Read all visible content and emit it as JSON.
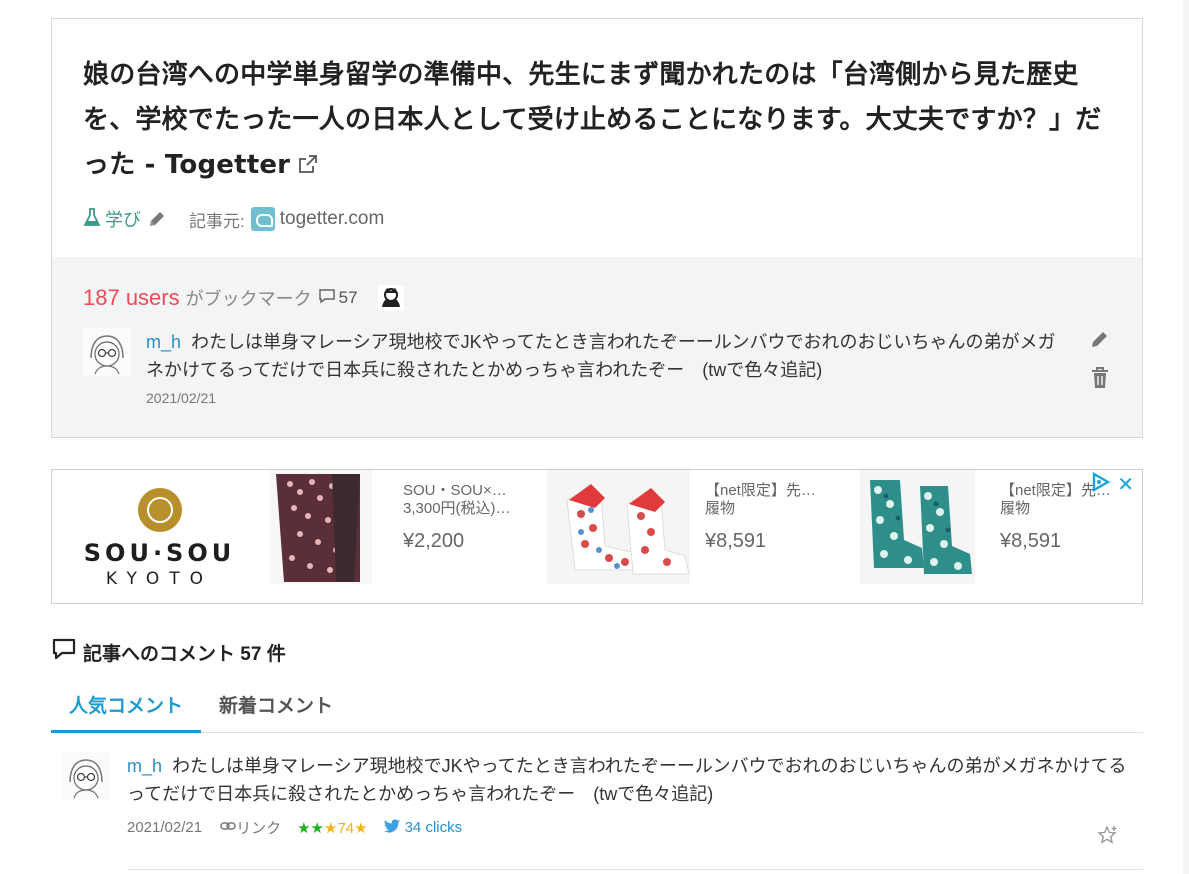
{
  "entry": {
    "title": "娘の台湾への中学単身留学の準備中、先生にまず聞かれたのは「台湾側から見た歴史を、学校でたった一人の日本人として受け止めることになります。大丈夫ですか？」だった - Togetter",
    "category": "学び",
    "source_label": "記事元:",
    "source_domain": "togetter.com"
  },
  "bookmarks": {
    "count": "187 users",
    "suffix": "がブックマーク",
    "comment_count": "57"
  },
  "my_comment": {
    "user": "m_h",
    "text": "わたしは単身マレーシア現地校でJKやってたとき言われたぞーールンバウでおれのおじいちゃんの弟がメガネかけてるってだけで日本兵に殺されたとかめっちゃ言われたぞー　(twで色々追記)",
    "date": "2021/02/21"
  },
  "ad": {
    "brand": "SOU·SOU",
    "brand_sub": "KYOTO",
    "items": [
      {
        "text": "SOU・SOU×…\n3,300円(税込)…",
        "price": "¥2,200"
      },
      {
        "text": "【net限定】先…\n履物",
        "price": "¥8,591"
      },
      {
        "text": "【net限定】先…\n履物",
        "price": "¥8,591"
      }
    ],
    "close": "✕"
  },
  "comments_section": {
    "heading": "記事へのコメント 57 件",
    "tabs": [
      "人気コメント",
      "新着コメント"
    ]
  },
  "top_comment": {
    "user": "m_h",
    "text": "わたしは単身マレーシア現地校でJKやってたとき言われたぞーールンバウでおれのおじいちゃんの弟がメガネかけてるってだけで日本兵に殺されたとかめっちゃ言われたぞー　(twで色々追記)",
    "date": "2021/02/21",
    "link_label": "リンク",
    "stars_green": "★★",
    "stars_yellow_a": "★",
    "star_count": "74",
    "stars_yellow_b": "★",
    "clicks": "34 clicks"
  },
  "colors": {
    "users_red": "#f04a55",
    "link_blue": "#2a8fc5",
    "tab_active": "#1d9bd1",
    "category_green": "#3c9a8a",
    "star_green": "#1eb31e",
    "star_yellow": "#f5b316"
  },
  "icons": [
    "external-link-icon",
    "flask-icon",
    "pencil-icon",
    "favicon-icon",
    "comment-bubble-icon",
    "trash-icon",
    "link-icon",
    "twitter-icon",
    "add-star-icon",
    "ad-choices-icon"
  ]
}
